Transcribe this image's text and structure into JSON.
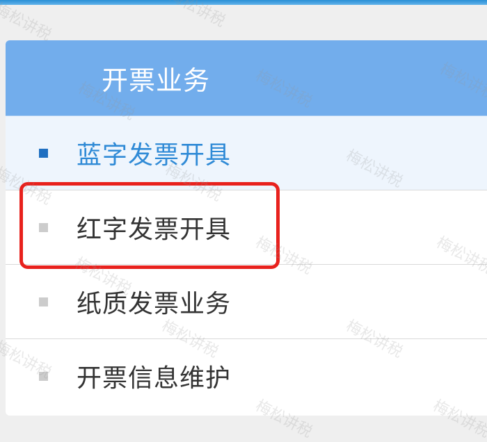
{
  "panel": {
    "title": "开票业务"
  },
  "menu": {
    "items": [
      {
        "label": "蓝字发票开具",
        "active": true
      },
      {
        "label": "红字发票开具",
        "active": false
      },
      {
        "label": "纸质发票业务",
        "active": false
      },
      {
        "label": "开票信息维护",
        "active": false
      }
    ]
  },
  "watermark": {
    "text": "梅松讲税"
  },
  "colors": {
    "header": "#72adec",
    "active_text": "#2f8ad6",
    "active_bullet": "#1f6fc1",
    "highlight": "#e8211d"
  }
}
